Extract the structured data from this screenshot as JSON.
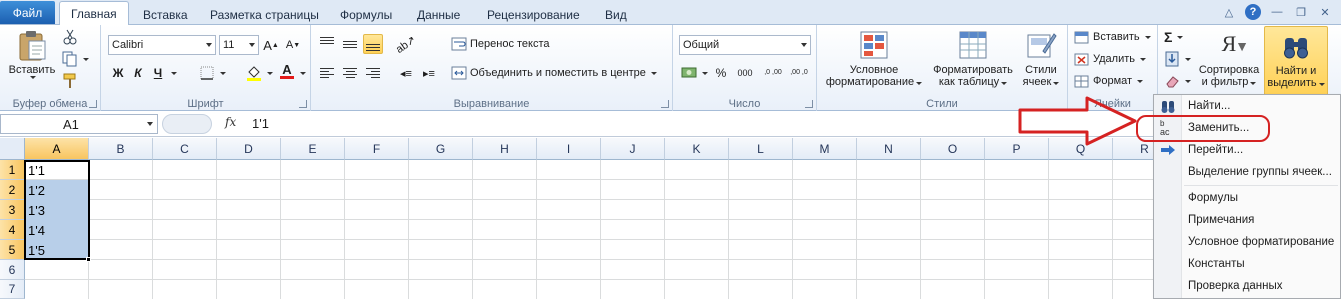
{
  "tabs": {
    "file": "Файл",
    "items": [
      "Главная",
      "Вставка",
      "Разметка страницы",
      "Формулы",
      "Данные",
      "Рецензирование",
      "Вид"
    ],
    "active_index": 0
  },
  "ribbon": {
    "clipboard": {
      "paste": "Вставить",
      "label": "Буфер обмена"
    },
    "font": {
      "name": "Calibri",
      "size": "11",
      "bold": "Ж",
      "italic": "К",
      "underline": "Ч",
      "grow": "A",
      "shrink": "A",
      "color_letter": "A",
      "label": "Шрифт"
    },
    "alignment": {
      "wrap": "Перенос текста",
      "merge": "Объединить и поместить в центре",
      "label": "Выравнивание"
    },
    "number": {
      "format": "Общий",
      "percent": "%",
      "thousands": "000",
      "dec_inc": ",0 ,00",
      "dec_dec": ",00 ,0",
      "label": "Число"
    },
    "styles": {
      "conditional": [
        "Условное",
        "форматирование"
      ],
      "as_table": [
        "Форматировать",
        "как таблицу"
      ],
      "cell_styles": [
        "Стили",
        "ячеек"
      ],
      "label": "Стили"
    },
    "cells": {
      "insert": "Вставить",
      "delete": "Удалить",
      "format": "Формат",
      "label": "Ячейки"
    },
    "editing": {
      "sigma": "Σ",
      "sort": [
        "Сортировка",
        "и фильтр"
      ],
      "find": [
        "Найти и",
        "выделить"
      ],
      "sort_glyph": "Я"
    }
  },
  "formula_bar": {
    "name_box": "A1",
    "fx": "fx",
    "content": "1'1"
  },
  "grid": {
    "columns": [
      "A",
      "B",
      "C",
      "D",
      "E",
      "F",
      "G",
      "H",
      "I",
      "J",
      "K",
      "L",
      "M",
      "N",
      "O",
      "P",
      "Q",
      "R"
    ],
    "rows": [
      "1",
      "2",
      "3",
      "4",
      "5",
      "6",
      "7"
    ],
    "a_values": [
      "1'1",
      "1'2",
      "1'3",
      "1'4",
      "1'5"
    ]
  },
  "menu": {
    "items": [
      "Найти...",
      "Заменить...",
      "Перейти...",
      "Выделение группы ячеек...",
      "Формулы",
      "Примечания",
      "Условное форматирование",
      "Константы",
      "Проверка данных"
    ],
    "replace_icon_text": "ac"
  },
  "colors": {
    "annotation": "#d52222",
    "selection": "#b8cfe9",
    "header_selected": "#f8c560"
  }
}
